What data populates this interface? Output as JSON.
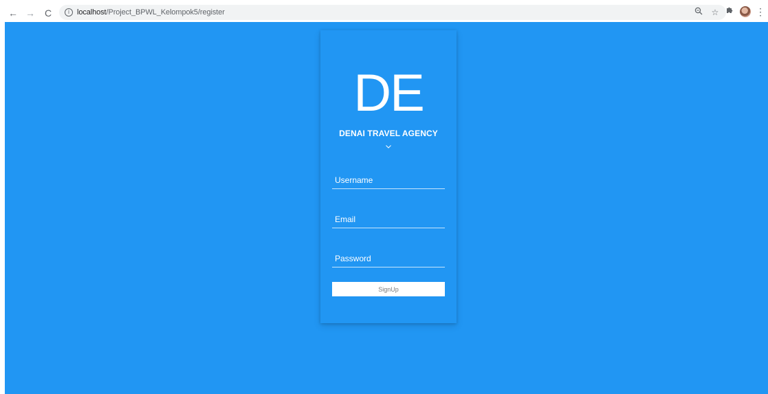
{
  "browser": {
    "url_host": "localhost",
    "url_path": "/Project_BPWL_Kelompok5/register",
    "icons": {
      "back": "arrow-left-icon",
      "forward": "arrow-right-icon",
      "reload": "reload-icon",
      "site_info": "info-icon",
      "zoom": "zoom-icon",
      "bookmark": "star-icon",
      "extensions": "puzzle-icon",
      "profile": "avatar",
      "menu": "kebab-menu-icon"
    }
  },
  "page": {
    "background_color": "#2196f3",
    "card": {
      "logo_text": "DE",
      "brand_name": "DENAI TRAVEL AGENCY",
      "fields": {
        "username": {
          "placeholder": "Username",
          "value": ""
        },
        "email": {
          "placeholder": "Email",
          "value": ""
        },
        "password": {
          "placeholder": "Password",
          "value": ""
        }
      },
      "submit_label": "SignUp"
    }
  }
}
